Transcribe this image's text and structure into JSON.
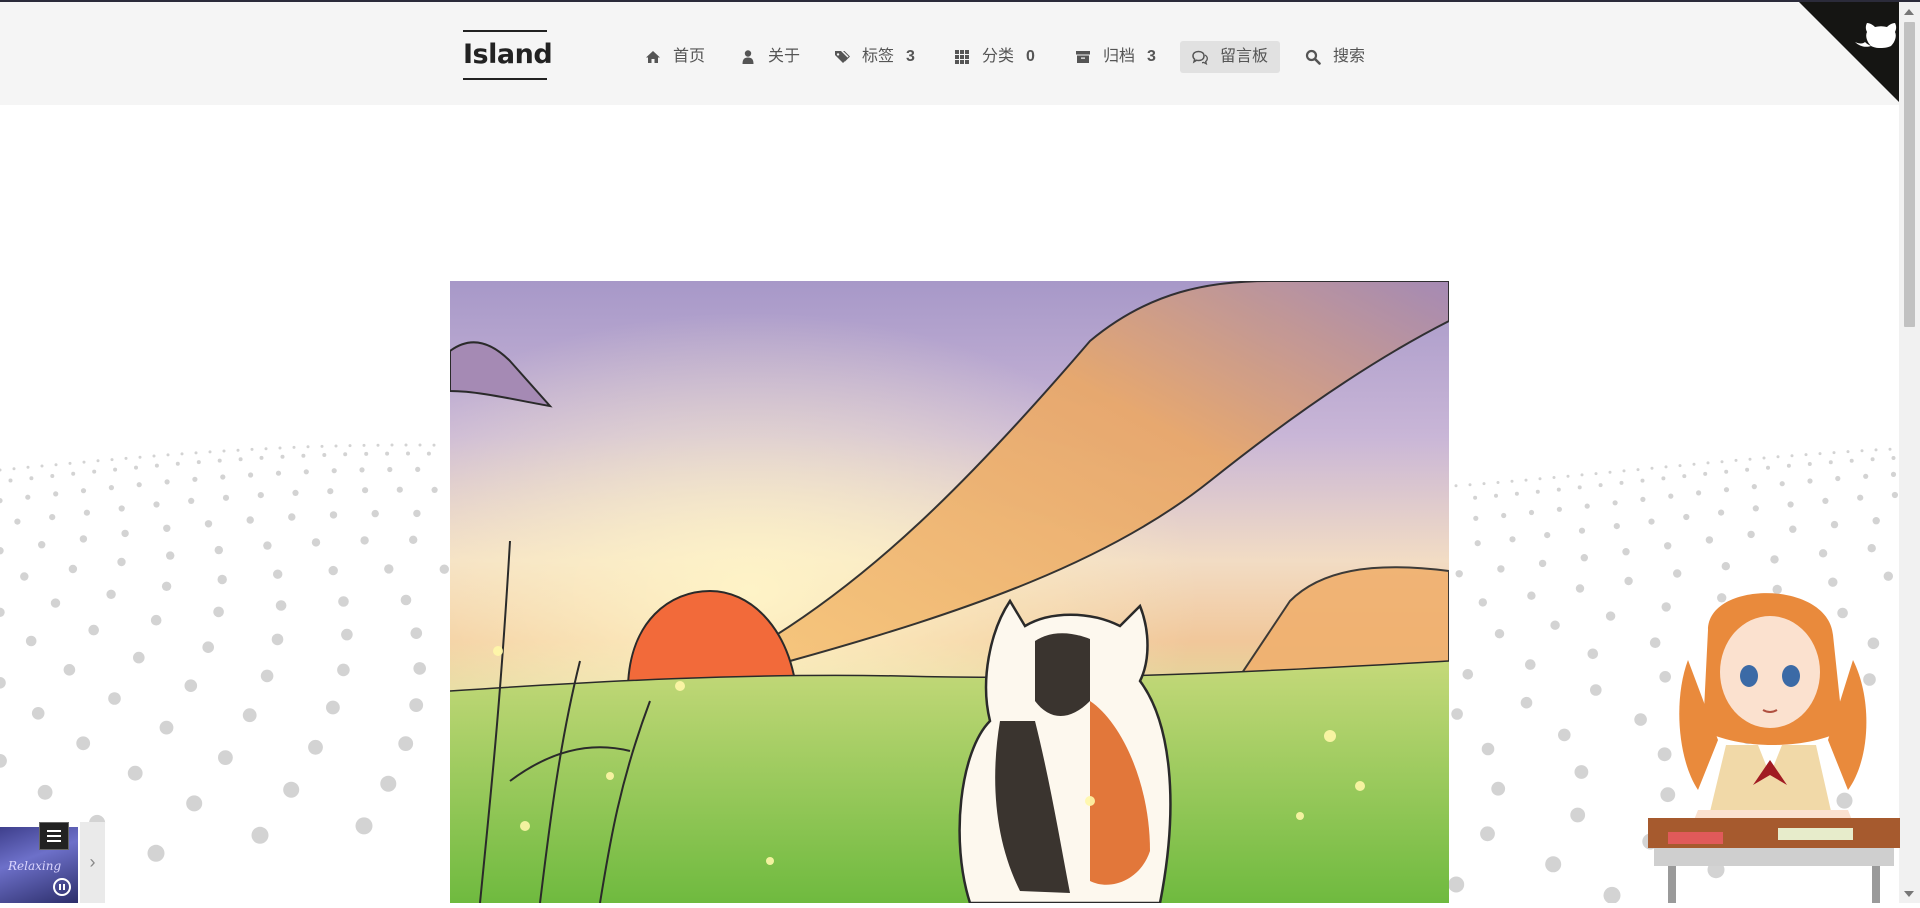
{
  "site": {
    "title": "Island"
  },
  "nav": {
    "items": [
      {
        "icon": "home-icon",
        "label": "首页"
      },
      {
        "icon": "user-icon",
        "label": "关于"
      },
      {
        "icon": "tags-icon",
        "label": "标签",
        "count": "3"
      },
      {
        "icon": "th-icon",
        "label": "分类",
        "count": "0"
      },
      {
        "icon": "archive-icon",
        "label": "归档",
        "count": "3"
      },
      {
        "icon": "comments-icon",
        "label": "留言板",
        "active": true
      },
      {
        "icon": "search-icon",
        "label": "搜索"
      }
    ]
  },
  "corner": {
    "icon": "github-icon"
  },
  "player": {
    "album_text": "Relaxing"
  },
  "colors": {
    "header_bg": "#f5f5f5",
    "active_bg": "#e1e1e1",
    "text": "#555555",
    "brand": "#222222"
  }
}
